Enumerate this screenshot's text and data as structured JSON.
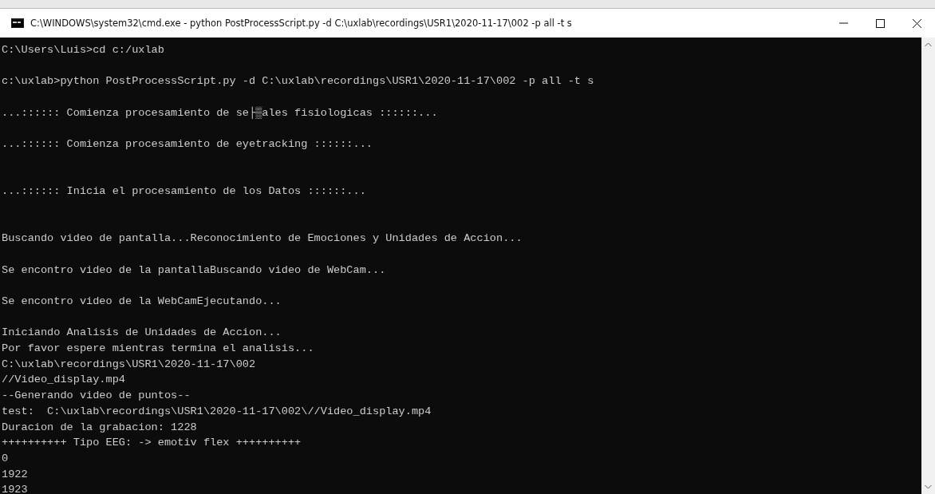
{
  "window": {
    "title": "C:\\WINDOWS\\system32\\cmd.exe - python  PostProcessScript.py -d C:\\uxlab\\recordings\\USR1\\2020-11-17\\002 -p all -t s"
  },
  "console": [
    {
      "kind": "text",
      "text": "C:\\Users\\Luis>cd c:/uxlab"
    },
    {
      "kind": "blank"
    },
    {
      "kind": "text",
      "text": "c:\\uxlab>python PostProcessScript.py -d C:\\uxlab\\recordings\\USR1\\2020-11-17\\002 -p all -t s"
    },
    {
      "kind": "blank"
    },
    {
      "kind": "text",
      "text": "...:::::: Comienza procesamiento de se├▒ales fisiologicas ::::::..."
    },
    {
      "kind": "blank"
    },
    {
      "kind": "text",
      "text": "...:::::: Comienza procesamiento de eyetracking ::::::..."
    },
    {
      "kind": "blank"
    },
    {
      "kind": "blank"
    },
    {
      "kind": "text",
      "text": "...:::::: Inicia el procesamiento de los Datos ::::::..."
    },
    {
      "kind": "blank"
    },
    {
      "kind": "blank"
    },
    {
      "kind": "text",
      "text": "Buscando video de pantalla...Reconocimiento de Emociones y Unidades de Accion..."
    },
    {
      "kind": "blank"
    },
    {
      "kind": "text",
      "text": "Se encontro video de la pantallaBuscando video de WebCam..."
    },
    {
      "kind": "blank"
    },
    {
      "kind": "text",
      "text": "Se encontro video de la WebCamEjecutando..."
    },
    {
      "kind": "blank"
    },
    {
      "kind": "text",
      "text": "Iniciando Analisis de Unidades de Accion..."
    },
    {
      "kind": "text",
      "text": "Por favor espere mientras termina el analisis..."
    },
    {
      "kind": "text",
      "text": "C:\\uxlab\\recordings\\USR1\\2020-11-17\\002"
    },
    {
      "kind": "text",
      "text": "//Video_display.mp4"
    },
    {
      "kind": "text",
      "text": "--Generando video de puntos--"
    },
    {
      "kind": "text",
      "text": "test:  C:\\uxlab\\recordings\\USR1\\2020-11-17\\002\\//Video_display.mp4"
    },
    {
      "kind": "text",
      "text": "Duracion de la grabacion: 1228"
    },
    {
      "kind": "text",
      "text": "++++++++++ Tipo EEG: -> emotiv flex ++++++++++"
    },
    {
      "kind": "text",
      "text": "0"
    },
    {
      "kind": "text",
      "text": "1922"
    },
    {
      "kind": "text",
      "text": "1923"
    }
  ]
}
